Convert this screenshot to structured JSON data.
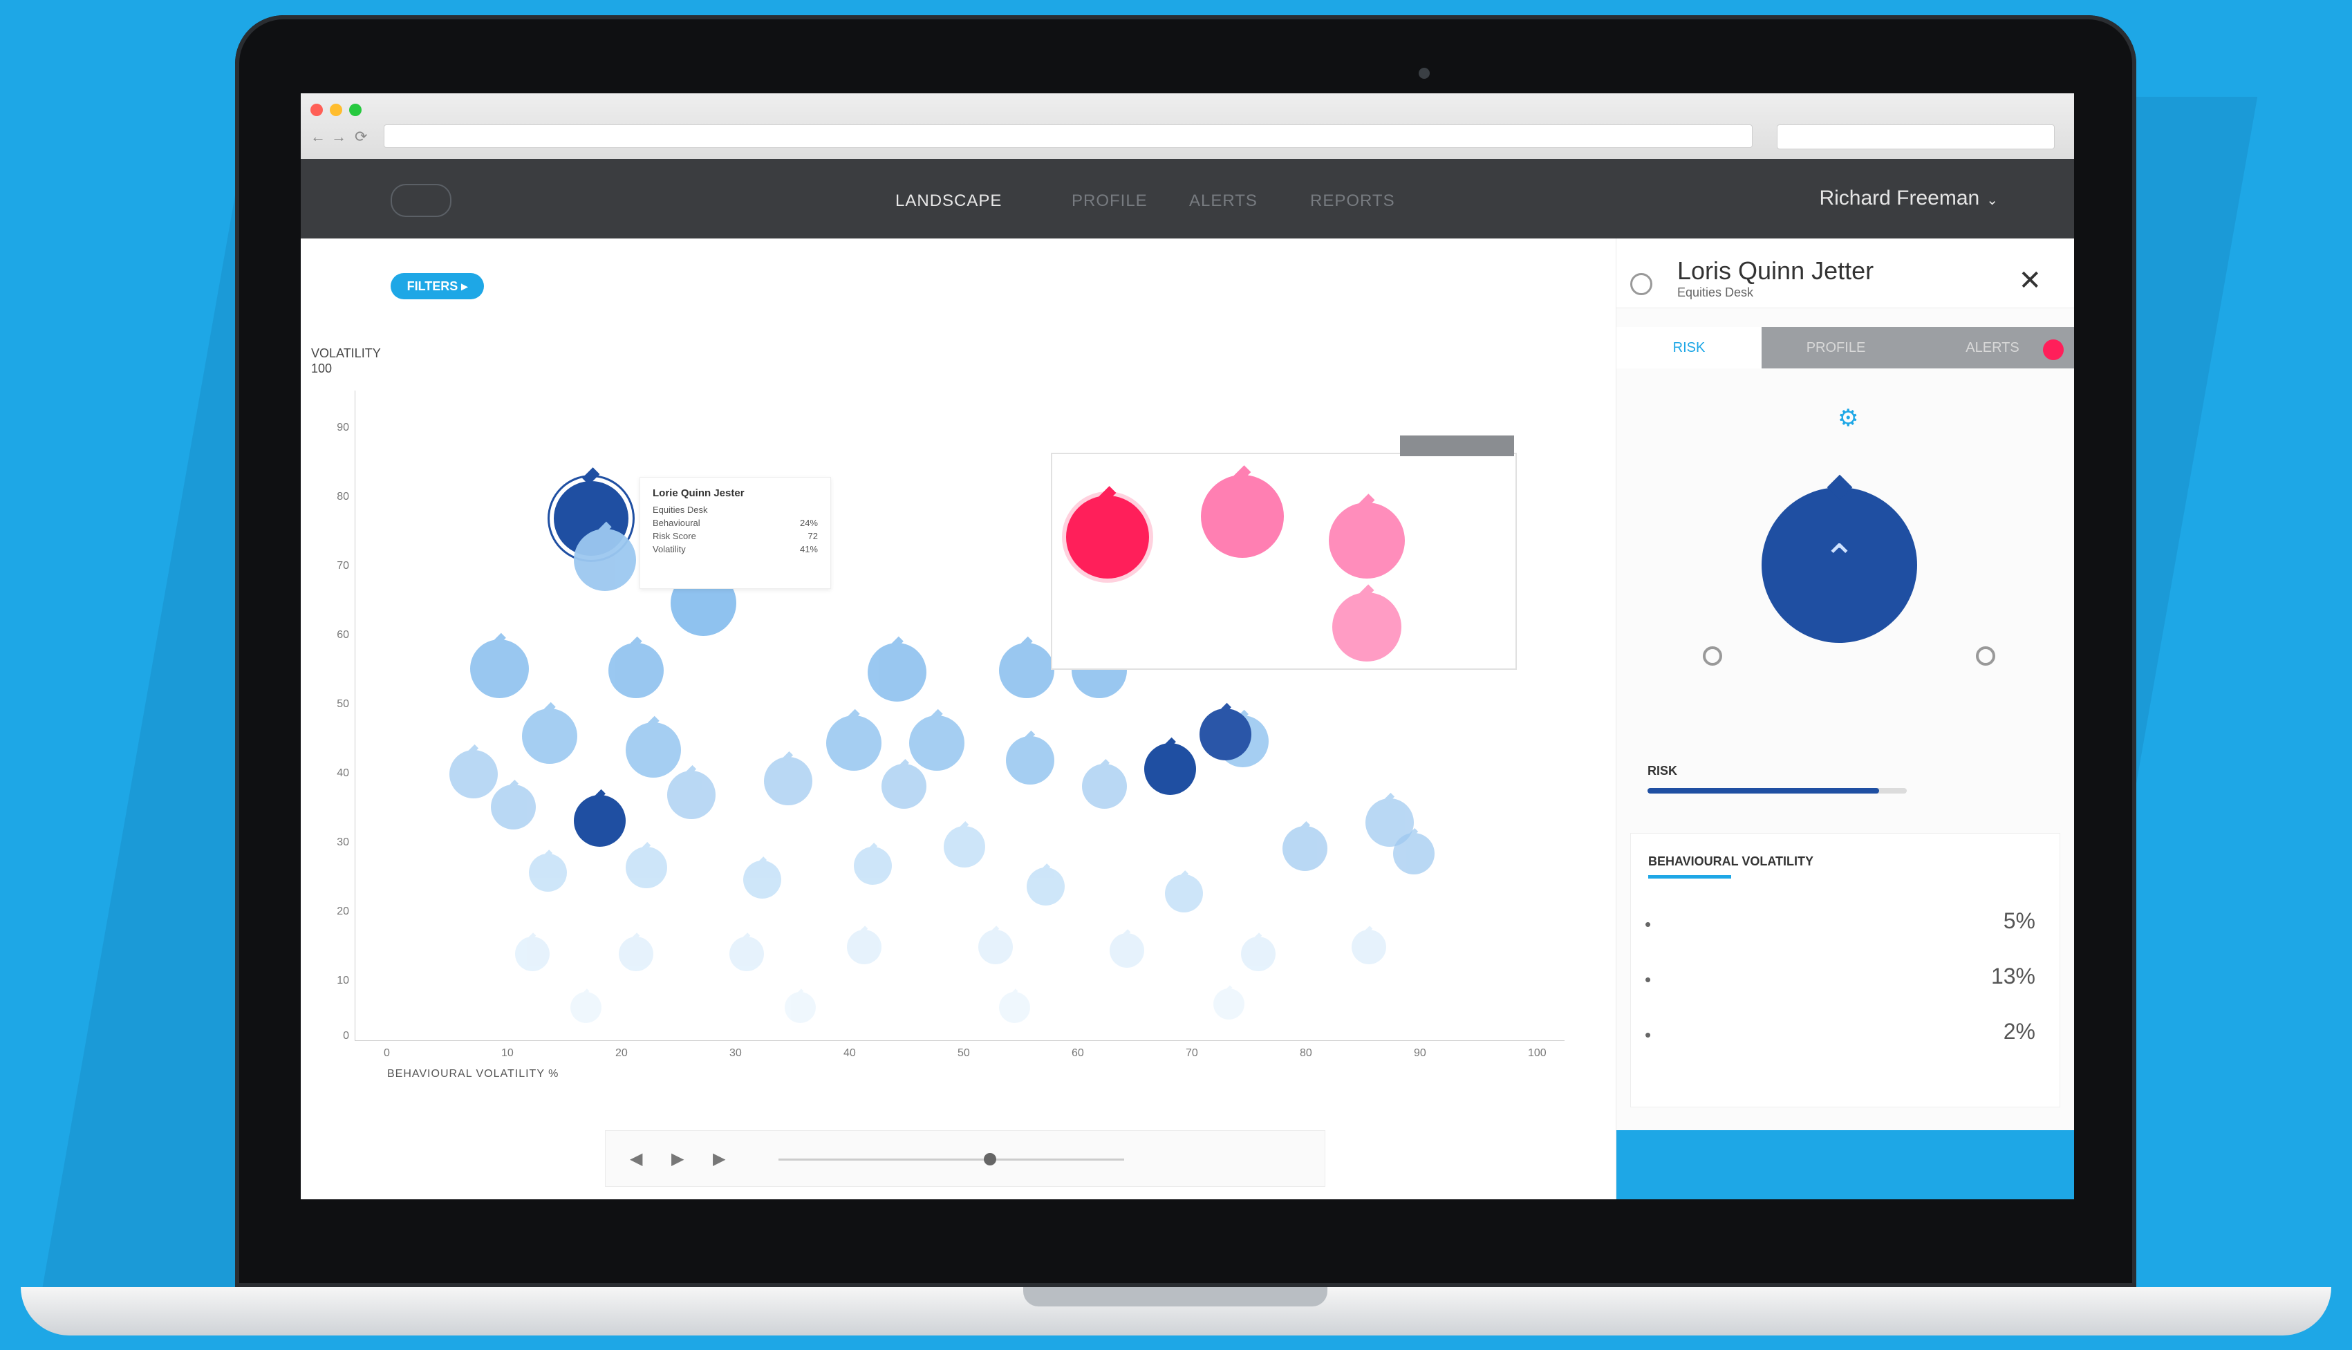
{
  "browser": {
    "url_text": "",
    "nav_back": "←",
    "nav_fwd": "→",
    "reload": "⟳"
  },
  "app": {
    "nav": {
      "tabs": [
        "LANDSCAPE",
        "PROFILE",
        "ALERTS",
        "REPORTS"
      ],
      "active_tab": "LANDSCAPE"
    },
    "user": {
      "name": "Richard Freeman"
    }
  },
  "main": {
    "filter_pill": "FILTERS ▸",
    "y_axis_title_line1": "VOLATILITY",
    "y_axis_title_line2": "100",
    "y_ticks": [
      "90",
      "80",
      "70",
      "60",
      "50",
      "40",
      "30",
      "20",
      "10",
      "0"
    ],
    "x_ticks": [
      "0",
      "10",
      "20",
      "30",
      "40",
      "50",
      "60",
      "70",
      "80",
      "90",
      "100"
    ],
    "x_axis_title": "BEHAVIOURAL VOLATILITY %",
    "tooltip": {
      "name": "Lorie Quinn Jester",
      "subtitle": "Equities Desk",
      "rows": [
        {
          "k": "Behavioural",
          "v": "24%"
        },
        {
          "k": "Risk Score",
          "v": "72"
        },
        {
          "k": "Volatility",
          "v": "41%"
        }
      ]
    },
    "inset_tag": "",
    "player": {
      "prev": "◀",
      "play": "▶",
      "next": "▶",
      "start_label": "",
      "end_label": "",
      "current_label_line1": "",
      "current_label_line2": ""
    }
  },
  "side_panel": {
    "name": "Loris Quinn Jetter",
    "subtitle": "Equities Desk",
    "close": "✕",
    "tabs": [
      "RISK",
      "PROFILE",
      "ALERTS"
    ],
    "active_tab": "RISK",
    "risk": {
      "label": "RISK",
      "value": ""
    },
    "bv": {
      "title": "BEHAVIOURAL VOLATILITY",
      "pct": "",
      "rows": [
        {
          "desc": "",
          "value": "5%"
        },
        {
          "desc": "",
          "value": "13%"
        },
        {
          "desc": "",
          "value": "2%"
        }
      ]
    },
    "cta": ""
  }
}
